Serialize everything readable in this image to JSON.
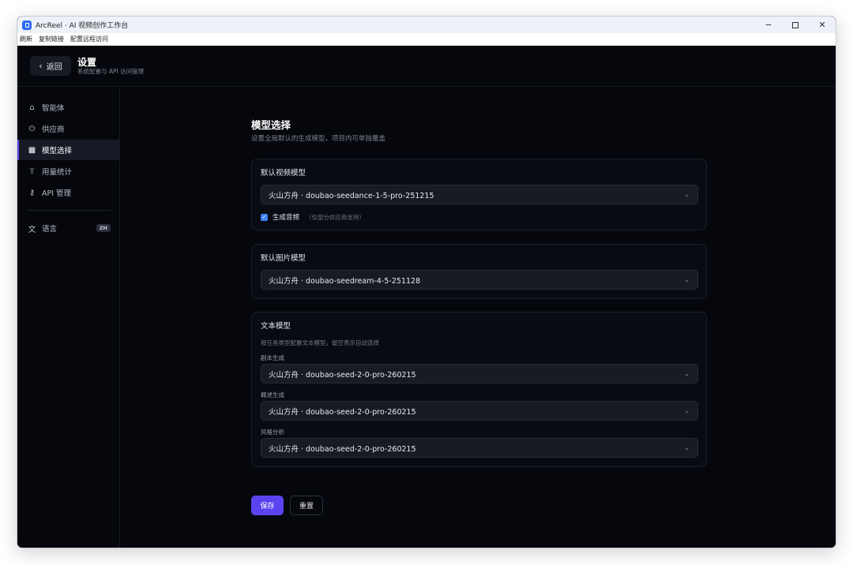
{
  "window": {
    "title": "ArcReel · AI 视频创作工作台",
    "controls": {
      "minimize": "−",
      "close": "✕"
    }
  },
  "menubar": {
    "items": [
      "刷新",
      "复制链接",
      "配置远程访问"
    ]
  },
  "header": {
    "back_label": "返回",
    "back_icon": "chevron-left-icon",
    "title": "设置",
    "subtitle": "系统配置与 API 访问管理"
  },
  "sidebar": {
    "items": [
      {
        "label": "智能体",
        "icon": "robot-icon",
        "glyph": "⌂",
        "active": false
      },
      {
        "label": "供应商",
        "icon": "plug-icon",
        "glyph": "⏻",
        "active": false
      },
      {
        "label": "模型选择",
        "icon": "film-icon",
        "glyph": "▦",
        "active": true
      },
      {
        "label": "用量统计",
        "icon": "bar-chart-icon",
        "glyph": "⫪",
        "active": false
      },
      {
        "label": "API 管理",
        "icon": "key-icon",
        "glyph": "⚷",
        "active": false
      }
    ],
    "language": {
      "label": "语言",
      "icon": "translate-icon",
      "glyph": "文",
      "badge": "ZH"
    }
  },
  "main": {
    "title": "模型选择",
    "description": "设置全局默认的生成模型，项目内可单独覆盖",
    "video_card": {
      "title": "默认视频模型",
      "selected": "火山方舟 · doubao-seedance-1-5-pro-251215",
      "audio_checkbox": {
        "checked": true,
        "label": "生成音频",
        "hint": "（仅部分供应商支持）"
      }
    },
    "image_card": {
      "title": "默认图片模型",
      "selected": "火山方舟 · doubao-seedream-4-5-251128"
    },
    "text_card": {
      "title": "文本模型",
      "description": "按任务类型配置文本模型，留空表示自动选择",
      "fields": [
        {
          "label": "剧本生成",
          "selected": "火山方舟 · doubao-seed-2-0-pro-260215"
        },
        {
          "label": "概述生成",
          "selected": "火山方舟 · doubao-seed-2-0-pro-260215"
        },
        {
          "label": "风格分析",
          "selected": "火山方舟 · doubao-seed-2-0-pro-260215"
        }
      ]
    },
    "actions": {
      "save_label": "保存",
      "reset_label": "重置"
    }
  },
  "colors": {
    "accent": "#5b43f0",
    "checkbox": "#3a82f6",
    "background": "#05070c"
  }
}
